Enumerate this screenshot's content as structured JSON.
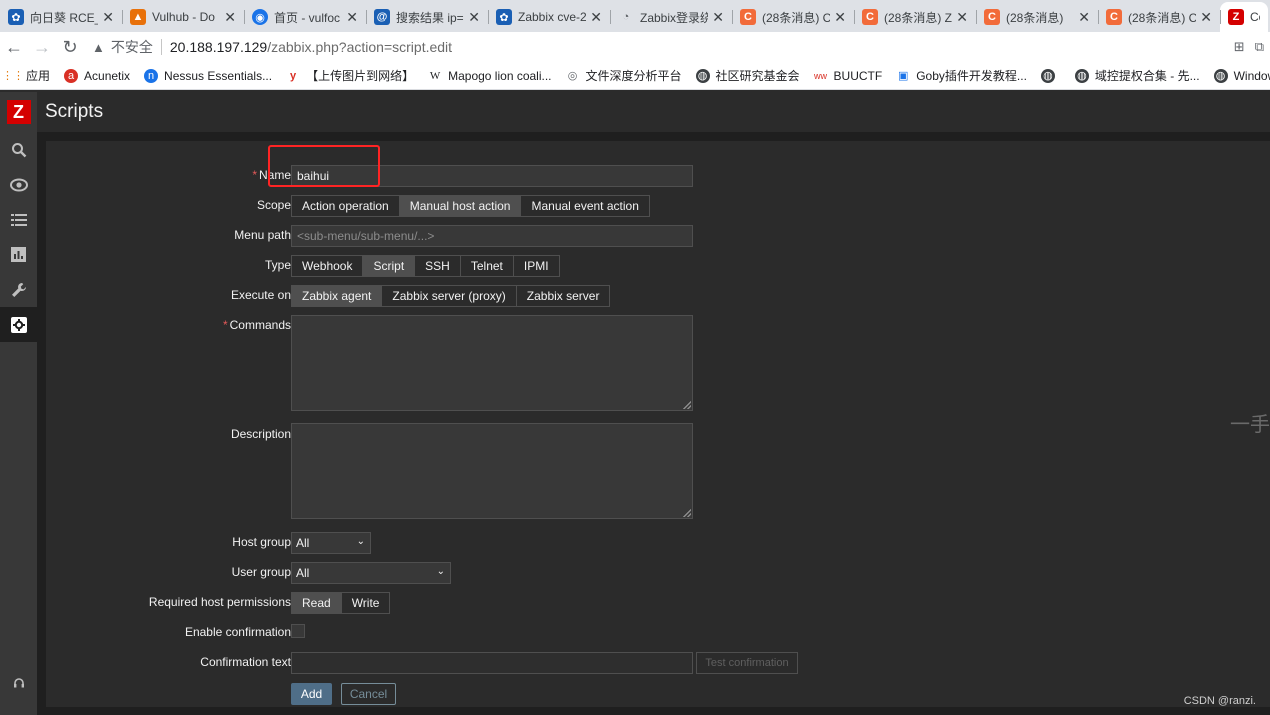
{
  "browser": {
    "tabs": [
      {
        "title": "向日葵 RCE_",
        "icon": "sunflower-icon",
        "color": "#1a5fb4"
      },
      {
        "title": "Vulhub - Do",
        "icon": "vulhub-icon",
        "color": "#e8710a"
      },
      {
        "title": "首页 - vulfoc",
        "icon": "shield-icon",
        "color": "#1a73e8"
      },
      {
        "title": "搜索结果 ip=",
        "icon": "search-result-icon",
        "color": "#1a5fb4"
      },
      {
        "title": "Zabbix cve-2",
        "icon": "zabbix-cve-icon",
        "color": "#1a5fb4"
      },
      {
        "title": "Zabbix登录绕",
        "icon": "github-icon",
        "color": "#5f6368"
      },
      {
        "title": "(28条消息) C",
        "icon": "csdn-icon",
        "color": "#f26b3a"
      },
      {
        "title": "(28条消息) Z",
        "icon": "csdn-icon",
        "color": "#f26b3a"
      },
      {
        "title": "(28条消息)",
        "icon": "csdn-icon",
        "color": "#f26b3a"
      },
      {
        "title": "(28条消息) C",
        "icon": "csdn-icon",
        "color": "#f26b3a"
      }
    ],
    "active_tab": {
      "title": "Co",
      "icon": "zabbix-z-icon",
      "color": "#d40000"
    },
    "address": {
      "insecure_label": "不安全",
      "host": "20.188.197.129",
      "path": "/zabbix.php?action=script.edit"
    },
    "bookmarks": [
      "应用",
      "Acunetix",
      "Nessus Essentials...",
      "【上传图片到网络】",
      "Mapogo lion coali...",
      "文件深度分析平台",
      "社区研究基金会",
      "BUUCTF",
      "Goby插件开发教程...",
      "域控提权合集 - 先...",
      "Windows内核提权..."
    ]
  },
  "zabbix": {
    "page_title": "Scripts",
    "form": {
      "name_label": "Name",
      "name_value": "baihui",
      "scope_label": "Scope",
      "scope_options": [
        "Action operation",
        "Manual host action",
        "Manual event action"
      ],
      "scope_selected": "Manual host action",
      "menu_path_label": "Menu path",
      "menu_path_placeholder": "<sub-menu/sub-menu/...>",
      "type_label": "Type",
      "type_options": [
        "Webhook",
        "Script",
        "SSH",
        "Telnet",
        "IPMI"
      ],
      "type_selected": "Script",
      "execute_on_label": "Execute on",
      "execute_on_options": [
        "Zabbix agent",
        "Zabbix server (proxy)",
        "Zabbix server"
      ],
      "execute_on_selected": "Zabbix agent",
      "commands_label": "Commands",
      "description_label": "Description",
      "host_group_label": "Host group",
      "host_group_value": "All",
      "user_group_label": "User group",
      "user_group_value": "All",
      "permissions_label": "Required host permissions",
      "permissions_options": [
        "Read",
        "Write"
      ],
      "permissions_selected": "Read",
      "enable_confirmation_label": "Enable confirmation",
      "confirmation_text_label": "Confirmation text",
      "test_confirmation_label": "Test confirmation",
      "add_label": "Add",
      "cancel_label": "Cancel"
    }
  },
  "watermark": "CSDN @ranzi.",
  "edge_char": "一手"
}
